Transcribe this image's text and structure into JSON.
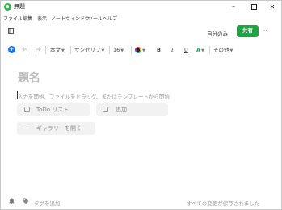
{
  "window": {
    "title": "無題"
  },
  "menu": [
    "ファイル",
    "編集",
    "表示",
    "ノート",
    "ウィンドウ",
    "ツール",
    "ヘルプ"
  ],
  "toolbar1": {
    "scope_label": "自分のみ",
    "share_label": "共有",
    "more_label": "···"
  },
  "toolbar2": {
    "insert_icon": "plus-icon",
    "style_label": "本文",
    "font_label": "サンセリフ",
    "size_label": "16",
    "bold_label": "B",
    "italic_label": "I",
    "underline_label": "U",
    "highlight_label": "A",
    "more_label": "その他"
  },
  "editor": {
    "title_placeholder": "題名",
    "body_placeholder": "入力を開始、ファイルをドラッグ、またはテンプレートから開始",
    "todo_label": "ToDo リスト",
    "add_label": "追加",
    "gallery_label": "ギャラリーを開く"
  },
  "footer": {
    "tag_placeholder": "タグを追加",
    "status": "すべての変更が保存されました"
  },
  "colors": {
    "accent": "#1ea446",
    "insert": "#1a73e8"
  }
}
